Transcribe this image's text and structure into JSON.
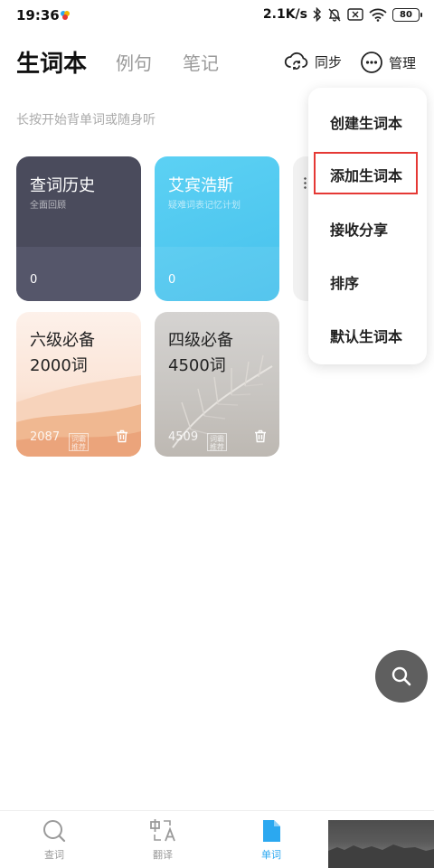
{
  "status_bar": {
    "time": "19:36",
    "network_speed": "2.1K/s",
    "battery": "80",
    "icons": [
      "app-icon",
      "bluetooth-icon",
      "mute-icon",
      "sim-icon",
      "wifi-icon",
      "battery-icon"
    ]
  },
  "header": {
    "tabs": [
      {
        "label": "生词本",
        "active": true
      },
      {
        "label": "例句",
        "active": false
      },
      {
        "label": "笔记",
        "active": false
      }
    ],
    "sync_label": "同步",
    "manage_label": "管理"
  },
  "hint": "长按开始背单词或随身听",
  "cards": {
    "history": {
      "title": "查词历史",
      "subtitle": "全面回顾",
      "count": "0"
    },
    "ebbinghaus": {
      "title": "艾宾浩斯",
      "subtitle": "疑难词表记忆计划",
      "count": "0"
    }
  },
  "books": [
    {
      "line1": "六级必备",
      "line2": "2000词",
      "count": "2087",
      "stamp": "词霸推荐"
    },
    {
      "line1": "四级必备",
      "line2": "4500词",
      "count": "4509",
      "stamp": "词霸推荐"
    }
  ],
  "dropdown": {
    "items": [
      "创建生词本",
      "添加生词本",
      "接收分享",
      "排序",
      "默认生词本"
    ],
    "highlighted_index": 1
  },
  "bottom_nav": [
    {
      "label": "查词",
      "active": false
    },
    {
      "label": "翻译",
      "active": false
    },
    {
      "label": "单词",
      "active": true
    }
  ],
  "colors": {
    "accent": "#2ba8f0",
    "highlight_border": "#e53935",
    "history_card": "#4a4b5c",
    "ebbinghaus_card": "#52c9f2",
    "fab": "#5f5f5f"
  }
}
